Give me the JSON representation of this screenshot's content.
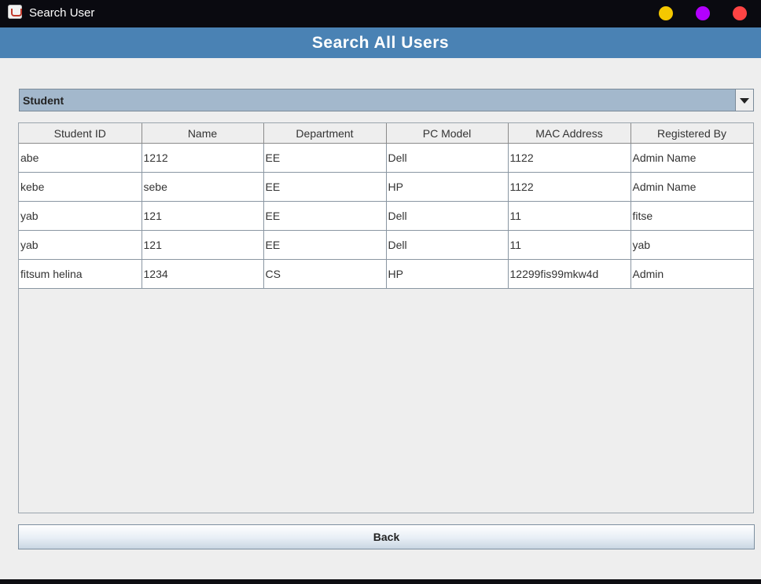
{
  "window": {
    "title": "Search User",
    "controls": {
      "minimize_color": "#f5c800",
      "maximize_color": "#b300ff",
      "close_color": "#ff4444"
    }
  },
  "header": {
    "title": "Search All Users",
    "background": "#4a82b4"
  },
  "filter": {
    "selected": "Student"
  },
  "table": {
    "columns": [
      "Student ID",
      "Name",
      "Department",
      "PC Model",
      "MAC Address",
      "Registered By"
    ],
    "rows": [
      [
        "abe",
        "1212",
        "EE",
        "Dell",
        "1122",
        "Admin Name"
      ],
      [
        "kebe",
        "sebe",
        "EE",
        "HP",
        "1122",
        "Admin Name"
      ],
      [
        "yab",
        "121",
        "EE",
        "Dell",
        "11",
        "fitse"
      ],
      [
        "yab",
        "121",
        "EE",
        "Dell",
        "11",
        "yab"
      ],
      [
        "fitsum helina",
        "1234",
        "CS",
        "HP",
        "12299fis99mkw4d",
        "Admin"
      ]
    ]
  },
  "back_button": {
    "label": "Back"
  }
}
